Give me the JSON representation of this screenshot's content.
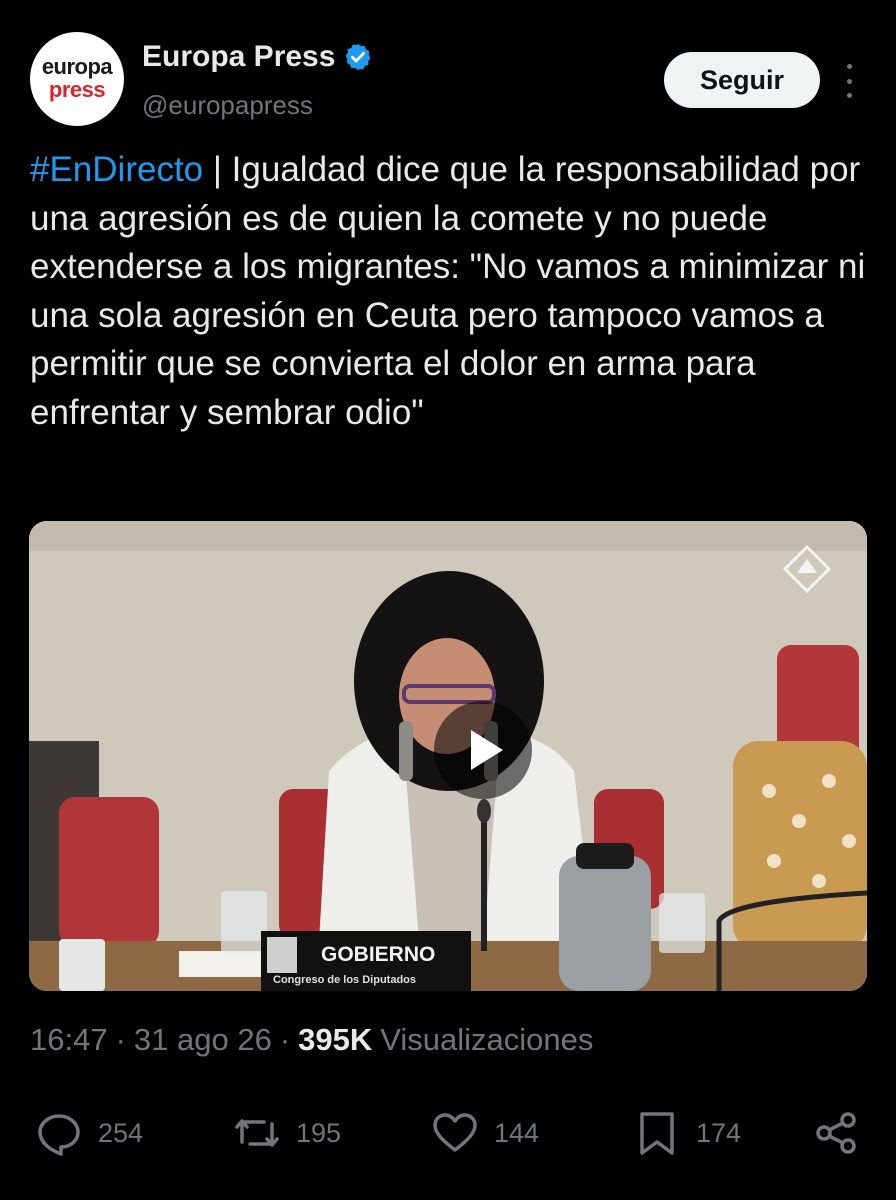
{
  "profile": {
    "avatar_line1": "europa",
    "avatar_line2": "press",
    "name": "Europa Press",
    "handle": "@europapress",
    "verified_icon": "verified-badge-icon"
  },
  "follow_button": "Seguir",
  "tweet": {
    "hashtag": "#EnDirecto",
    "text": " | Igualdad dice que la responsabilidad por una agresión es de quien la comete y no puede extenderse a los migrantes: \"No vamos a minimizar ni una sola agresión en Ceuta pero tampoco vamos a permitir que se convierta el dolor en arma para enfrentar y sembrar odio\""
  },
  "video": {
    "nameplate": "GOBIERNO",
    "nameplate_sub": "Congreso de los Diputados"
  },
  "meta": {
    "time": "16:47",
    "date": "31 ago 26",
    "views_count": "395K",
    "views_label": "Visualizaciones",
    "separator": "·"
  },
  "actions": {
    "replies": "254",
    "reposts": "195",
    "likes": "144",
    "bookmarks": "174"
  },
  "colors": {
    "background": "#000000",
    "accent": "#1d9bf0",
    "secondary_text": "#71767b",
    "primary_text": "#e7e9ea"
  }
}
